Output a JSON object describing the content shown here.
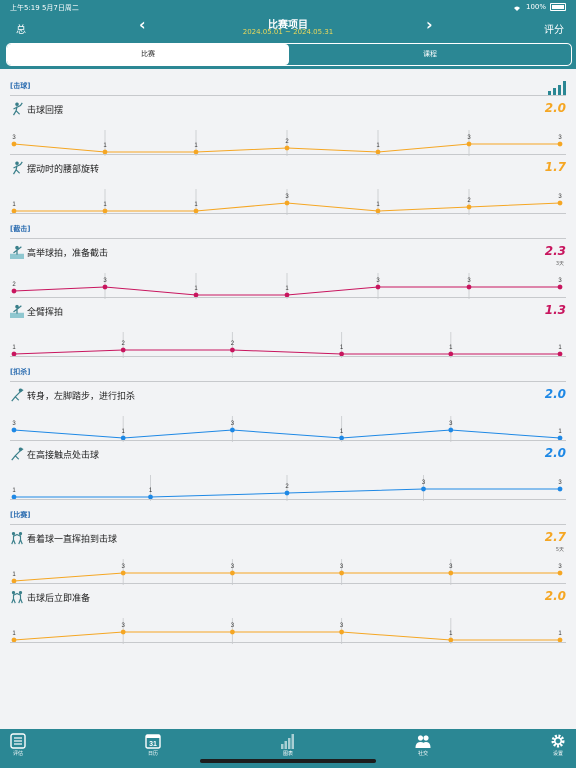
{
  "status_bar": {
    "time": "上午5:19  5月7日周二",
    "battery": "100%"
  },
  "header": {
    "left": "总",
    "title": "比赛项目",
    "subtitle": "2024.05.01 ~ 2024.05.31",
    "right": "评分"
  },
  "segments": {
    "match": "比赛",
    "course": "课程"
  },
  "colors": {
    "header": "#2b8794",
    "orange": "#f5a623",
    "magenta": "#c8155e",
    "blue": "#1e88e5"
  },
  "sections": [
    {
      "label": "[击球]",
      "items": [
        {
          "title": "击球回摆",
          "score": "2.0",
          "sub": "",
          "color": "#f5a623",
          "icon": "hit-player-icon",
          "values": [
            3,
            1,
            1,
            2,
            1,
            3,
            3
          ],
          "labels": [
            "3",
            "1",
            "1",
            "2",
            "1",
            "3",
            "3"
          ],
          "slots": 7
        },
        {
          "title": "摆动时的腰部旋转",
          "score": "1.7",
          "sub": "",
          "color": "#f5a623",
          "icon": "hit-player-icon",
          "values": [
            1,
            1,
            1,
            3,
            1,
            2,
            3
          ],
          "labels": [
            "1",
            "1",
            "1",
            "3",
            "1",
            "2",
            "3"
          ],
          "slots": 7
        }
      ]
    },
    {
      "label": "[截击]",
      "items": [
        {
          "title": "高举球拍，准备截击",
          "score": "2.3",
          "sub": "3天",
          "color": "#c8155e",
          "icon": "volley-player-icon",
          "values": [
            2,
            3,
            1,
            1,
            3,
            3,
            3
          ],
          "labels": [
            "2",
            "3",
            "1",
            "1",
            "3",
            "3",
            "3"
          ],
          "slots": 7
        },
        {
          "title": "全臂挥拍",
          "score": "1.3",
          "sub": "",
          "color": "#c8155e",
          "icon": "volley-player-icon",
          "values": [
            1,
            2,
            2,
            1,
            1,
            1
          ],
          "labels": [
            "1",
            "2",
            "2",
            "1",
            "1",
            "1"
          ],
          "slots": 6
        }
      ]
    },
    {
      "label": "[扣杀]",
      "items": [
        {
          "title": "转身，左脚踏步，进行扣杀",
          "score": "2.0",
          "sub": "",
          "color": "#1e88e5",
          "icon": "smash-player-icon",
          "values": [
            3,
            1,
            3,
            1,
            3,
            1
          ],
          "labels": [
            "3",
            "1",
            "3",
            "1",
            "3",
            "1"
          ],
          "slots": 6
        },
        {
          "title": "在高接触点处击球",
          "score": "2.0",
          "sub": "",
          "color": "#1e88e5",
          "icon": "smash-player-icon",
          "values": [
            1,
            1,
            2,
            3,
            3
          ],
          "labels": [
            "1",
            "1",
            "2",
            "3",
            "3"
          ],
          "slots": 5
        }
      ]
    },
    {
      "label": "[比赛]",
      "items": [
        {
          "title": "看着球一直挥拍到击球",
          "score": "2.7",
          "sub": "5天",
          "color": "#f5a623",
          "icon": "match-players-icon",
          "values": [
            1,
            3,
            3,
            3,
            3,
            3
          ],
          "labels": [
            "1",
            "3",
            "3",
            "3",
            "3",
            "3"
          ],
          "slots": 6
        },
        {
          "title": "击球后立即准备",
          "score": "2.0",
          "sub": "",
          "color": "#f5a623",
          "icon": "match-players-icon",
          "values": [
            1,
            3,
            3,
            3,
            1,
            1
          ],
          "labels": [
            "1",
            "3",
            "3",
            "3",
            "1",
            "1"
          ],
          "slots": 6
        }
      ]
    }
  ],
  "tabs": [
    {
      "label": "评估",
      "icon": "list-icon"
    },
    {
      "label": "日历",
      "icon": "calendar-icon",
      "day": "31"
    },
    {
      "label": "图表",
      "icon": "chart-icon"
    },
    {
      "label": "社交",
      "icon": "people-icon"
    },
    {
      "label": "设置",
      "icon": "gear-icon"
    }
  ],
  "chart_data": [
    {
      "type": "line",
      "title": "击球回摆",
      "values": [
        3,
        1,
        1,
        2,
        1,
        3,
        3
      ]
    },
    {
      "type": "line",
      "title": "摆动时的腰部旋转",
      "values": [
        1,
        1,
        1,
        3,
        1,
        2,
        3
      ]
    },
    {
      "type": "line",
      "title": "高举球拍，准备截击",
      "values": [
        2,
        3,
        1,
        1,
        3,
        3,
        3
      ]
    },
    {
      "type": "line",
      "title": "全臂挥拍",
      "values": [
        1,
        2,
        2,
        1,
        1,
        1
      ]
    },
    {
      "type": "line",
      "title": "转身，左脚踏步，进行扣杀",
      "values": [
        3,
        1,
        3,
        1,
        3,
        1
      ]
    },
    {
      "type": "line",
      "title": "在高接触点处击球",
      "values": [
        1,
        1,
        2,
        3,
        3
      ]
    },
    {
      "type": "line",
      "title": "看着球一直挥拍到击球",
      "values": [
        1,
        3,
        3,
        3,
        3,
        3
      ]
    },
    {
      "type": "line",
      "title": "击球后立即准备",
      "values": [
        1,
        3,
        3,
        3,
        1,
        1
      ]
    }
  ]
}
